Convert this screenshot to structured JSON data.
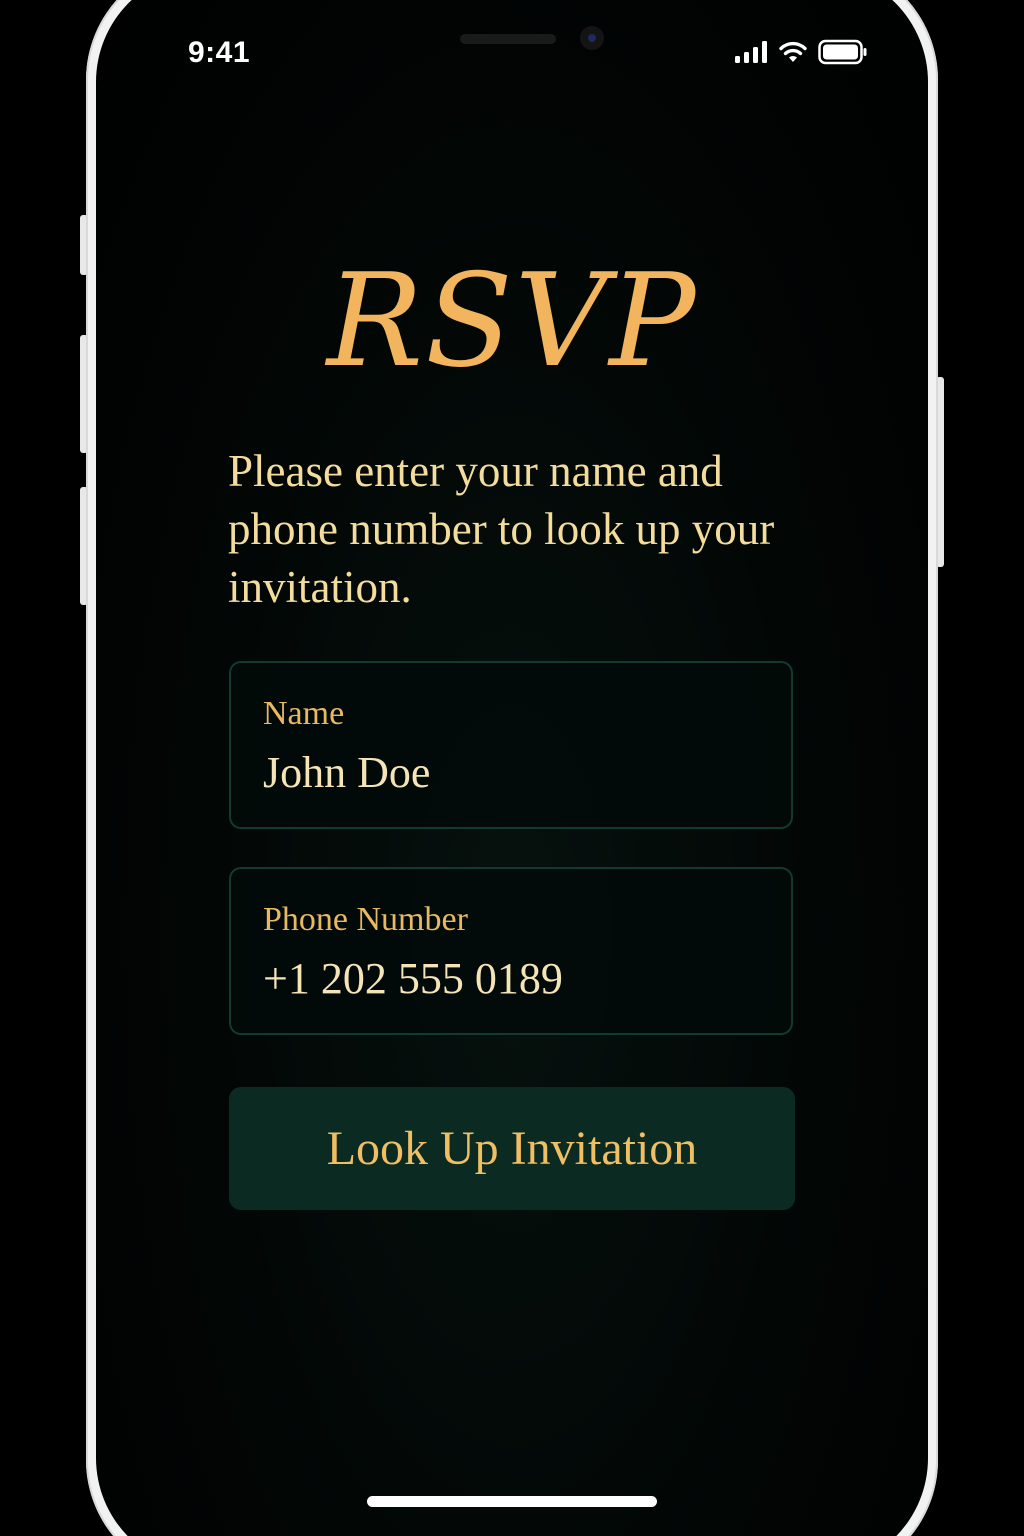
{
  "status_bar": {
    "time": "9:41",
    "icons": [
      "cellular-signal-icon",
      "wifi-icon",
      "battery-icon"
    ]
  },
  "rsvp": {
    "title": "RSVP",
    "instructions": "Please enter your name and phone number to look up your invitation."
  },
  "form": {
    "name": {
      "label": "Name",
      "value": "John Doe"
    },
    "phone": {
      "label": "Phone Number",
      "value": "+1 202 555 0189"
    },
    "submit_label": "Look Up Invitation"
  },
  "colors": {
    "accent_gold": "#f2b55e",
    "text_cream": "#f3dc9c",
    "button_green": "#0a2a22",
    "field_border": "#143a2f",
    "background": "#000000"
  }
}
